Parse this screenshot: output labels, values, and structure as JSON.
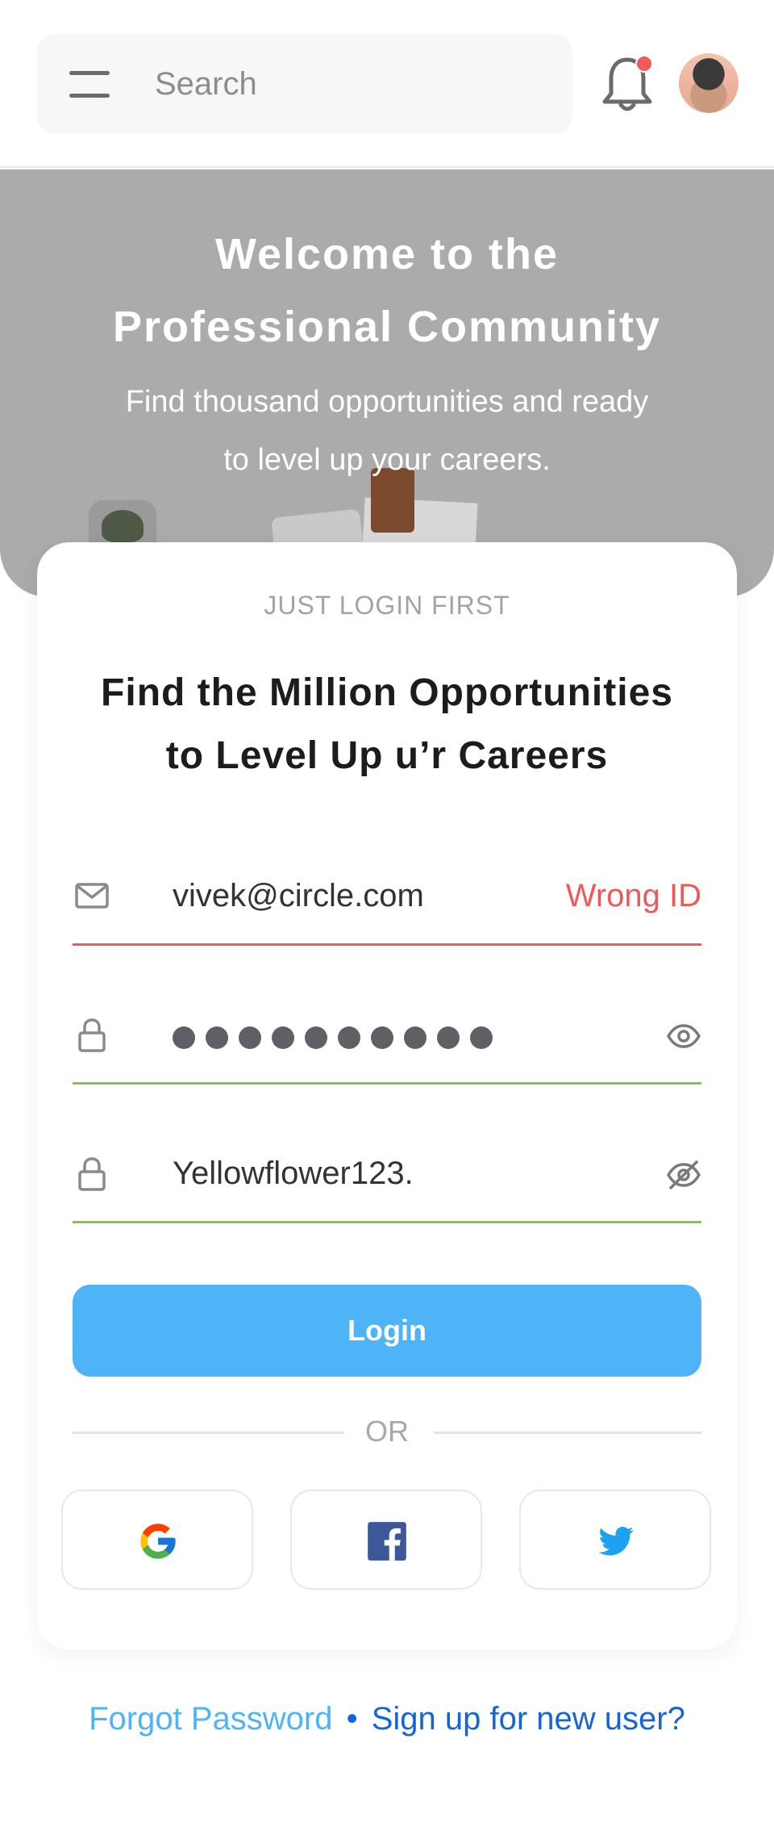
{
  "header": {
    "search_placeholder": "Search",
    "has_notification": true
  },
  "hero": {
    "title_line1": "Welcome to the",
    "title_line2": "Professional Community",
    "subtitle_line1": "Find thousand opportunities and ready",
    "subtitle_line2": "to level up your careers."
  },
  "card": {
    "eyebrow": "JUST LOGIN FIRST",
    "title_line1": "Find the Million Opportunities",
    "title_line2": "to Level Up u’r Careers",
    "email_value": "vivek@circle.com",
    "email_error": "Wrong ID",
    "password_masked_count": 10,
    "confirm_value": "Yellowflower123.",
    "login_label": "Login",
    "or_label": "OR",
    "social": [
      {
        "name": "google-icon"
      },
      {
        "name": "facebook-icon"
      },
      {
        "name": "twitter-icon"
      }
    ]
  },
  "footer": {
    "forgot_label": "Forgot Password",
    "separator": "•",
    "signup_label": "Sign up for new user?"
  },
  "colors": {
    "accent": "#4fb3f7",
    "error": "#ec5a5a",
    "valid": "#8bc34a",
    "link_dark": "#1565d8"
  }
}
